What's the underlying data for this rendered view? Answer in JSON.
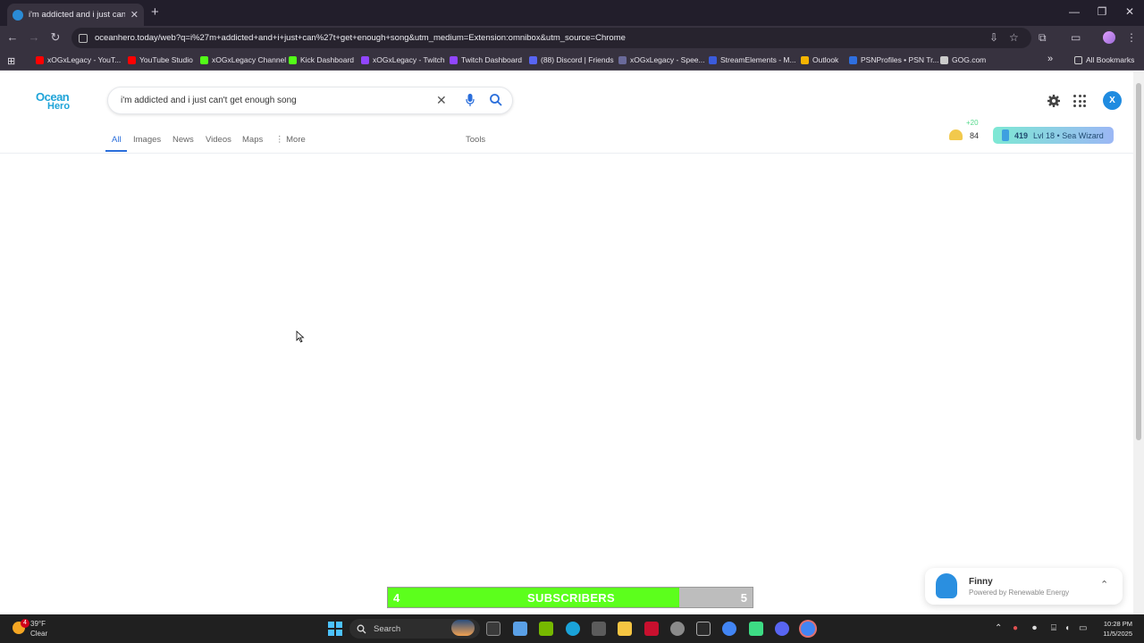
{
  "browser": {
    "tab_title": "i'm addicted and i just can't ge",
    "tab_close": "✕",
    "new_tab": "+",
    "url": "oceanhero.today/web?q=i%27m+addicted+and+i+just+can%27t+get+enough+song&utm_medium=Extension:omnibox&utm_source=Chrome",
    "window_controls": {
      "minimize": "—",
      "restore": "❐",
      "close": "✕"
    },
    "nav": {
      "back": "←",
      "forward": "→",
      "reload": "↻"
    },
    "all_bookmarks": "All Bookmarks",
    "bookmarks_overflow": "»",
    "bookmarks": [
      {
        "label": "xOGxLegacy - YouT...",
        "color": "#ff0000"
      },
      {
        "label": "YouTube Studio",
        "color": "#ff0000"
      },
      {
        "label": "xOGxLegacy Channel",
        "color": "#53fc18"
      },
      {
        "label": "Kick Dashboard",
        "color": "#53fc18"
      },
      {
        "label": "xOGxLegacy - Twitch",
        "color": "#9146ff"
      },
      {
        "label": "Twitch Dashboard",
        "color": "#9146ff"
      },
      {
        "label": "(88) Discord | Friends",
        "color": "#5865f2"
      },
      {
        "label": "xOGxLegacy - Spee...",
        "color": "#6a6a9a"
      },
      {
        "label": "StreamElements - M...",
        "color": "#3b5bdb"
      },
      {
        "label": "Outlook",
        "color": "#f5b400"
      },
      {
        "label": "PSNProfiles • PSN Tr...",
        "color": "#2f6fdf"
      },
      {
        "label": "GOG.com",
        "color": "#cccccc"
      }
    ]
  },
  "page": {
    "logo_line1": "Ocean",
    "logo_line2": "Hero",
    "search_query": "i'm addicted and i just can't get enough song",
    "clear": "✕",
    "tabs": [
      {
        "label": "All",
        "active": true
      },
      {
        "label": "Images"
      },
      {
        "label": "News"
      },
      {
        "label": "Videos"
      },
      {
        "label": "Maps"
      },
      {
        "label": "⋮ More"
      }
    ],
    "tools": "Tools",
    "avatar_initial": "X",
    "shell_bonus": "+20",
    "shell_count": "84",
    "bottle_count": "419",
    "level_text": "Lvl 18 • Sea Wizard"
  },
  "subscribers": {
    "current": "4",
    "label": "SUBSCRIBERS",
    "goal": "5",
    "progress": 0.8
  },
  "finny": {
    "name": "Finny",
    "subtitle": "Powered by Renewable Energy",
    "chevron": "⌃"
  },
  "taskbar": {
    "temp": "39°F",
    "condition": "Clear",
    "weather_badge": "4",
    "search_placeholder": "Search",
    "time": "10:28 PM",
    "date": "11/5/2025"
  }
}
